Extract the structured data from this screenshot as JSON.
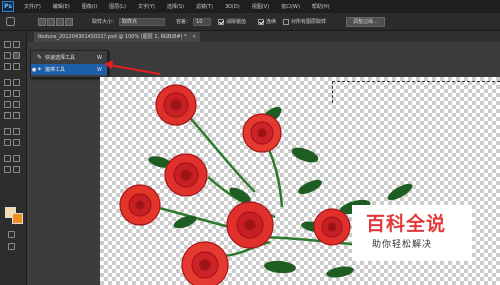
{
  "app": {
    "logo": "Ps"
  },
  "menu": {
    "items": [
      "文件(F)",
      "编辑(E)",
      "图像(I)",
      "图层(L)",
      "文字(Y)",
      "选择(S)",
      "滤镜(T)",
      "3D(D)",
      "视图(V)",
      "窗口(W)",
      "帮助(H)"
    ]
  },
  "options_bar": {
    "sample_size_label": "取样大小：",
    "sample_size_value": "取样点",
    "tolerance_label": "容差：",
    "tolerance_value": "10",
    "antialias_label": "消除锯齿",
    "contiguous_label": "连续",
    "sample_all_label": "对所有图层取样",
    "refine_edge_label": "调整边缘..."
  },
  "document_tab": {
    "title": "Reduce_20120430145022?.psd @ 100% (图层 1, RGB/8#) *",
    "close": "×"
  },
  "tool_flyout": {
    "items": [
      {
        "label": "快速选择工具",
        "shortcut": "W",
        "icon": "quick-selection-icon",
        "selected": false
      },
      {
        "label": "魔棒工具",
        "shortcut": "W",
        "icon": "magic-wand-icon",
        "selected": true
      }
    ]
  },
  "colors": {
    "foreground": "#f5dcae",
    "background": "#ef8e1c",
    "annotation_arrow": "#e02020",
    "rose": "#e0302c"
  },
  "watermark": {
    "title": "百科全说",
    "subtitle": "助你轻松解决"
  }
}
